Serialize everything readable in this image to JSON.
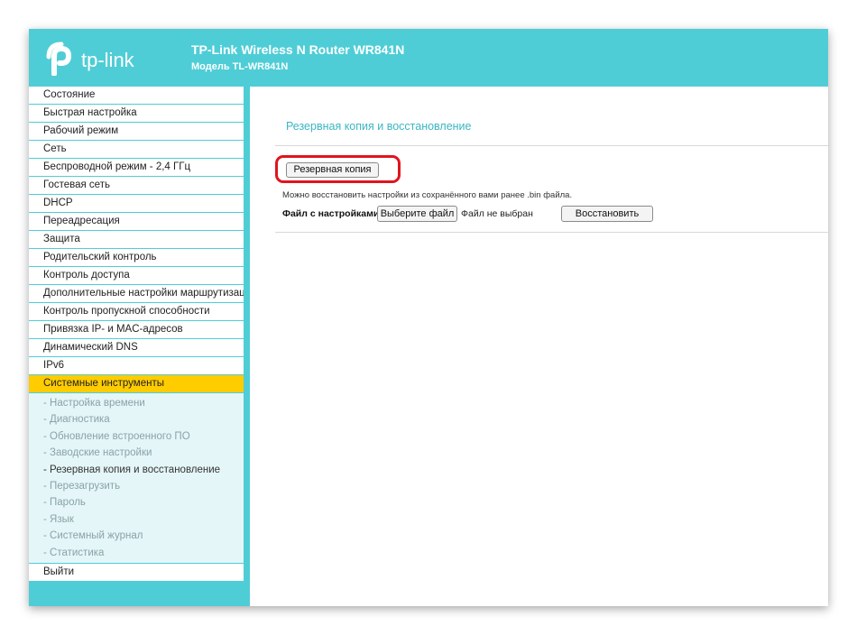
{
  "header": {
    "logo_text": "tp-link",
    "title": "TP-Link Wireless N Router WR841N",
    "model": "Модель TL-WR841N"
  },
  "sidebar": {
    "items": [
      {
        "label": "Состояние"
      },
      {
        "label": "Быстрая настройка"
      },
      {
        "label": "Рабочий режим"
      },
      {
        "label": "Сеть"
      },
      {
        "label": "Беспроводной режим - 2,4 ГГц"
      },
      {
        "label": "Гостевая сеть"
      },
      {
        "label": "DHCP"
      },
      {
        "label": "Переадресация"
      },
      {
        "label": "Защита"
      },
      {
        "label": "Родительский контроль"
      },
      {
        "label": "Контроль доступа"
      },
      {
        "label": "Дополнительные настройки маршрутизации"
      },
      {
        "label": "Контроль пропускной способности"
      },
      {
        "label": "Привязка IP- и MAC-адресов"
      },
      {
        "label": "Динамический DNS"
      },
      {
        "label": "IPv6"
      }
    ],
    "active_item": {
      "label": "Системные инструменты"
    },
    "subitems": [
      {
        "label": "- Настройка времени"
      },
      {
        "label": "- Диагностика"
      },
      {
        "label": "- Обновление встроенного ПО"
      },
      {
        "label": "- Заводские настройки"
      },
      {
        "label": "- Резервная копия и восстановление"
      },
      {
        "label": "- Перезагрузить"
      },
      {
        "label": "- Пароль"
      },
      {
        "label": "- Язык"
      },
      {
        "label": "- Системный журнал"
      },
      {
        "label": "- Статистика"
      }
    ],
    "logout": {
      "label": "Выйти"
    }
  },
  "main": {
    "title": "Резервная копия и восстановление",
    "backup_button": "Резервная копия",
    "hint": "Можно восстановить настройки из сохранённого вами ранее .bin файла.",
    "file_label": "Файл с настройками:",
    "choose_button": "Выберите файл",
    "no_file": "Файл не выбран",
    "restore_button": "Восстановить"
  },
  "colors": {
    "brand": "#4fcdd6",
    "active_menu": "#ffcc00",
    "highlight": "#e0141e",
    "title_text": "#3bb6c3"
  }
}
